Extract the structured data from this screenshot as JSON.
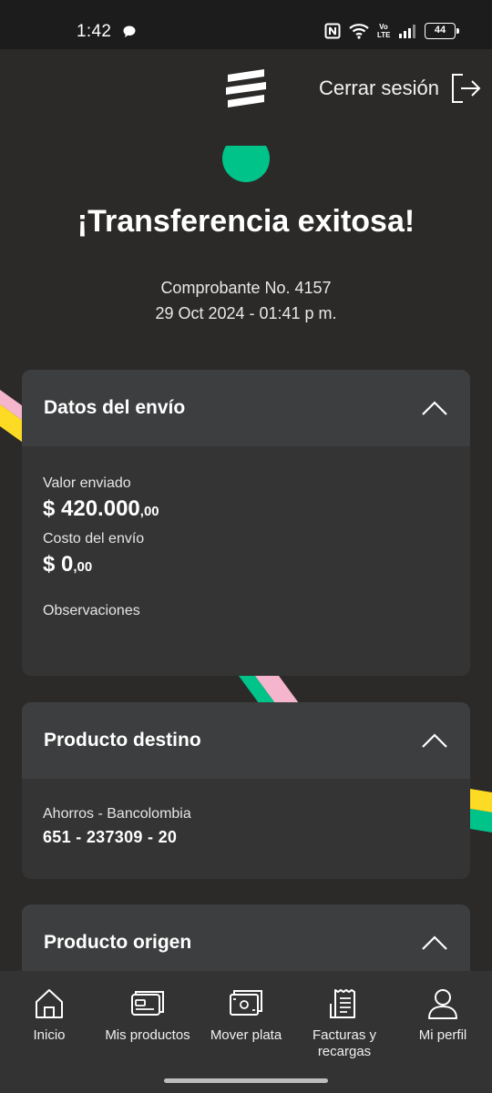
{
  "status_bar": {
    "time": "1:42",
    "battery": "44",
    "network": "Vo LTE"
  },
  "header": {
    "logo": "bancolombia-logo",
    "logout_label": "Cerrar sesión"
  },
  "result": {
    "title": "¡Transferencia exitosa!",
    "receipt": "Comprobante No. 4157",
    "datetime": "29 Oct 2024 - 01:41 p m."
  },
  "shipping_card": {
    "title": "Datos del envío",
    "sent_label": "Valor enviado",
    "sent_amount": "$ 420.000",
    "sent_cents": ",00",
    "cost_label": "Costo del envío",
    "cost_amount": "$ 0",
    "cost_cents": ",00",
    "notes_label": "Observaciones"
  },
  "destination_card": {
    "title": "Producto destino",
    "account_type": "Ahorros - Bancolombia",
    "account_number": "651 - 237309 - 20"
  },
  "origin_card": {
    "title": "Producto origen"
  },
  "bottom_nav": [
    {
      "label": "Inicio",
      "icon": "home-icon"
    },
    {
      "label": "Mis productos",
      "icon": "cards-icon"
    },
    {
      "label": "Mover plata",
      "icon": "money-icon"
    },
    {
      "label": "Facturas y recargas",
      "icon": "receipt-icon"
    },
    {
      "label": "Mi perfil",
      "icon": "profile-icon"
    }
  ],
  "colors": {
    "background": "#2b2a28",
    "card": "#343434",
    "card_header": "#3d3e3f",
    "accent_green": "#00c389",
    "accent_yellow": "#fdda24",
    "accent_pink": "#f5b6cd"
  }
}
